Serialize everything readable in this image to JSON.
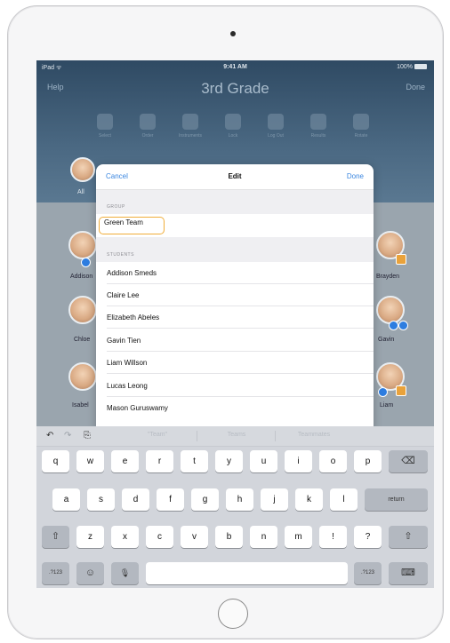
{
  "device": {
    "type": "iPad"
  },
  "status_bar": {
    "carrier": "iPad ᯤ",
    "time": "9:41 AM",
    "battery": "100%"
  },
  "nav": {
    "left": "Help",
    "title": "3rd Grade",
    "right": "Done"
  },
  "toolbar": {
    "items": [
      "Select",
      "Order",
      "Instruments",
      "Lock",
      "Log Out",
      "Results",
      "Rotate"
    ]
  },
  "background_students": {
    "left": [
      "All",
      "Addison",
      "Chloe",
      "Isabel"
    ],
    "right": [
      "Brayden",
      "Gavin",
      "Liam"
    ]
  },
  "modal": {
    "cancel": "Cancel",
    "title": "Edit",
    "done": "Done",
    "group_header": "GROUP",
    "group_value": "Green Team",
    "students_header": "STUDENTS",
    "students": [
      "Addison Smeds",
      "Claire Lee",
      "Elizabeth Abeles",
      "Gavin Tien",
      "Liam Willson",
      "Lucas Leong",
      "Mason Guruswamy"
    ]
  },
  "keyboard": {
    "suggestions": [
      "\"Team\"",
      "Teams",
      "Teammates"
    ],
    "row1": [
      "q",
      "w",
      "e",
      "r",
      "t",
      "y",
      "u",
      "i",
      "o",
      "p"
    ],
    "row2": [
      "a",
      "s",
      "d",
      "f",
      "g",
      "h",
      "j",
      "k",
      "l"
    ],
    "row3": [
      "z",
      "x",
      "c",
      "v",
      "b",
      "n",
      "m",
      "!",
      "?"
    ],
    "return": "return",
    "numbers_key": ".?123",
    "shift": "⇧",
    "delete": "⌫",
    "emoji": "☺",
    "mic": "🎙",
    "hide": "⌨",
    "undo": "↶",
    "redo": "↷",
    "paste": "⎘"
  },
  "colors": {
    "accent": "#3a86e0",
    "highlight": "#f0ad3a"
  }
}
